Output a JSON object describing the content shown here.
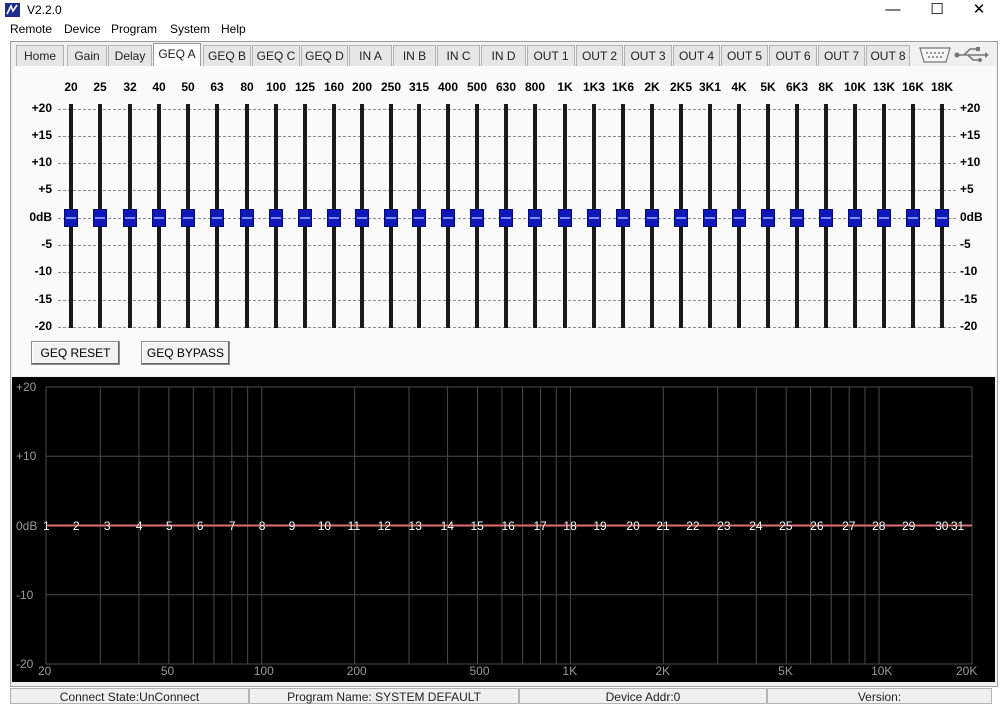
{
  "window": {
    "title": "V2.2.0",
    "minimize_glyph": "—",
    "maximize_glyph": "☐",
    "close_glyph": "✕"
  },
  "menu": [
    "Remote",
    "Device",
    "Program",
    "System",
    "Help"
  ],
  "tabs": [
    "Home",
    "Gain",
    "Delay",
    "GEQ A",
    "GEQ B",
    "GEQ C",
    "GEQ D",
    "IN A",
    "IN B",
    "IN C",
    "IN D",
    "OUT 1",
    "OUT 2",
    "OUT 3",
    "OUT 4",
    "OUT 5",
    "OUT 6",
    "OUT 7",
    "OUT 8"
  ],
  "active_tab": "GEQ A",
  "geq": {
    "frequencies": [
      "20",
      "25",
      "32",
      "40",
      "50",
      "63",
      "80",
      "100",
      "125",
      "160",
      "200",
      "250",
      "315",
      "400",
      "500",
      "630",
      "800",
      "1K",
      "1K3",
      "1K6",
      "2K",
      "2K5",
      "3K1",
      "4K",
      "5K",
      "6K3",
      "8K",
      "10K",
      "13K",
      "16K",
      "18K"
    ],
    "scale_labels": [
      "+20",
      "+15",
      "+10",
      "+5",
      "0dB",
      "-5",
      "-10",
      "-15",
      "-20"
    ],
    "gains_db": [
      0,
      0,
      0,
      0,
      0,
      0,
      0,
      0,
      0,
      0,
      0,
      0,
      0,
      0,
      0,
      0,
      0,
      0,
      0,
      0,
      0,
      0,
      0,
      0,
      0,
      0,
      0,
      0,
      0,
      0,
      0
    ],
    "reset_label": "GEQ RESET",
    "bypass_label": "GEQ BYPASS",
    "knob_color": "#0e17b8"
  },
  "graph": {
    "y_labels": [
      "+20",
      "+10",
      "0dB",
      "-10",
      "-20"
    ],
    "x_labels": [
      "20",
      "50",
      "100",
      "200",
      "500",
      "1K",
      "2K",
      "5K",
      "10K",
      "20K"
    ],
    "band_numbers": [
      "1",
      "2",
      "3",
      "4",
      "5",
      "6",
      "7",
      "8",
      "9",
      "10",
      "11",
      "12",
      "13",
      "14",
      "15",
      "16",
      "17",
      "18",
      "19",
      "20",
      "21",
      "22",
      "23",
      "24",
      "25",
      "26",
      "27",
      "28",
      "29",
      "30",
      "31"
    ],
    "curve_color": "#e07070"
  },
  "status": {
    "connect": "Connect State:UnConnect",
    "program": "Program Name: SYSTEM DEFAULT",
    "device": "Device Addr:0",
    "version": "Version:"
  },
  "icons": {
    "port": "serial-port-icon",
    "usb": "usb-icon"
  }
}
